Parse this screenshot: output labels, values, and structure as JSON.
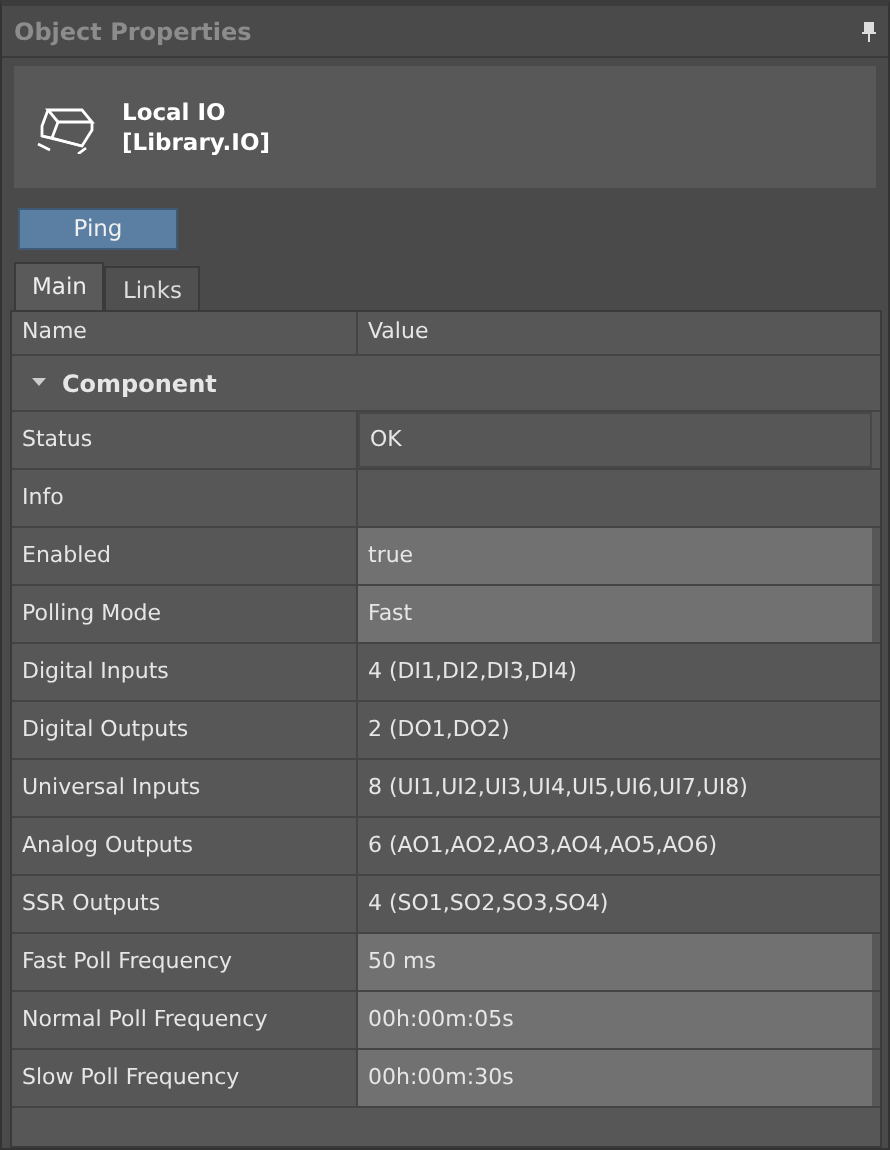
{
  "window": {
    "title": "Object Properties"
  },
  "object": {
    "name": "Local IO",
    "type": "[Library.IO]"
  },
  "buttons": [
    "Ping"
  ],
  "tabs": [
    {
      "label": "Main",
      "selected": true
    },
    {
      "label": "Links",
      "selected": false
    }
  ],
  "table": {
    "columns": [
      "Name",
      "Value"
    ],
    "group": {
      "label": "Component",
      "expanded": true
    },
    "rows": [
      {
        "name": "Status",
        "value": "OK",
        "editable": false
      },
      {
        "name": "Info",
        "editable": false
      },
      {
        "name": "Enabled",
        "value": "true",
        "editable": true
      },
      {
        "name": "Polling Mode",
        "value": "Fast",
        "editable": true
      },
      {
        "name": "Digital Inputs",
        "value": "4 (DI1,DI2,DI3,DI4)",
        "editable": false
      },
      {
        "name": "Digital Outputs",
        "value": "2 (DO1,DO2)",
        "editable": false
      },
      {
        "name": "Universal Inputs",
        "value": "8 (UI1,UI2,UI3,UI4,UI5,UI6,UI7,UI8)",
        "editable": false
      },
      {
        "name": "Analog Outputs",
        "value": "6 (AO1,AO2,AO3,AO4,AO5,AO6)",
        "editable": false
      },
      {
        "name": "SSR Outputs",
        "value": "4 (SO1,SO2,SO3,SO4)",
        "editable": false
      },
      {
        "name": "Fast Poll Frequency",
        "value": "50 ms",
        "editable": true
      },
      {
        "name": "Normal Poll Frequency",
        "value": "00h:00m:05s",
        "editable": true
      },
      {
        "name": "Slow Poll Frequency",
        "value": "00h:00m:30s",
        "editable": true
      }
    ]
  }
}
